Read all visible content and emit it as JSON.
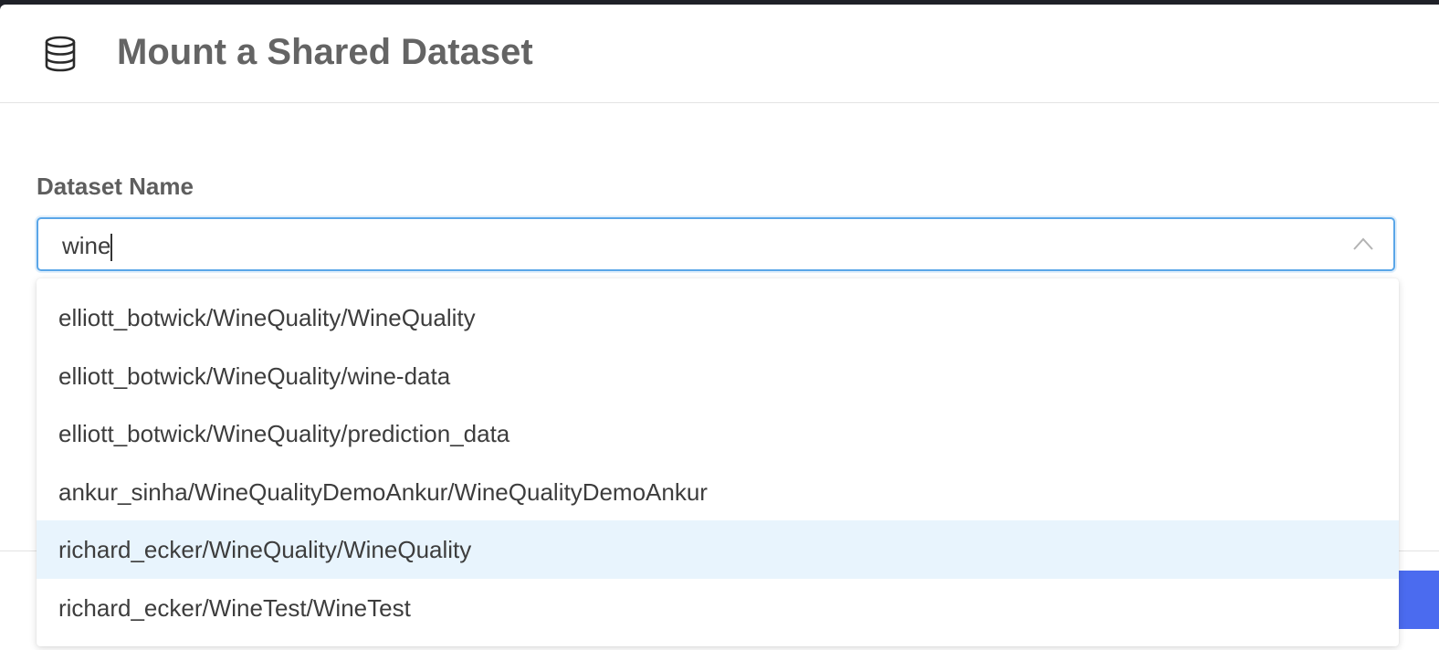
{
  "dialog": {
    "title": "Mount a Shared Dataset",
    "icon": "database-icon"
  },
  "field": {
    "label": "Dataset Name",
    "value": "wine",
    "toggle_icon": "chevron-up-icon"
  },
  "dropdown": {
    "options": [
      {
        "label": "elliott_botwick/WineQuality/WineQuality",
        "highlighted": false
      },
      {
        "label": "elliott_botwick/WineQuality/wine-data",
        "highlighted": false
      },
      {
        "label": "elliott_botwick/WineQuality/prediction_data",
        "highlighted": false
      },
      {
        "label": "ankur_sinha/WineQualityDemoAnkur/WineQualityDemoAnkur",
        "highlighted": false
      },
      {
        "label": "richard_ecker/WineQuality/WineQuality",
        "highlighted": true
      },
      {
        "label": "richard_ecker/WineTest/WineTest",
        "highlighted": false
      }
    ]
  },
  "colors": {
    "accent": "#4b6bef",
    "focus_border": "#5aa6e8",
    "highlight_row": "#e8f4fd"
  }
}
